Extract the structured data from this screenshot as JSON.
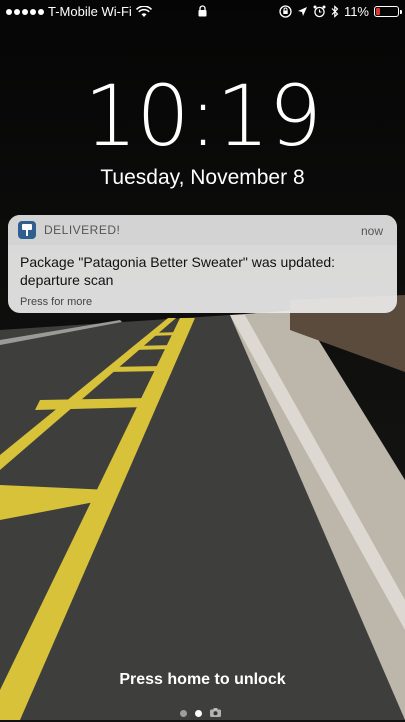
{
  "status_bar": {
    "carrier": "T-Mobile Wi-Fi",
    "battery_percent": "11%",
    "battery_level": 0.11,
    "icons": [
      "signal-dots-icon",
      "wifi-icon",
      "lock-icon",
      "orientation-lock-icon",
      "location-arrow-icon",
      "alarm-icon",
      "bluetooth-icon",
      "battery-icon"
    ]
  },
  "lock_screen": {
    "time": "10:19",
    "date": "Tuesday, November 8",
    "unlock_hint": "Press home to unlock"
  },
  "notification": {
    "app_name": "DELIVERED!",
    "time": "now",
    "message": "Package \"Patagonia Better Sweater\" was updated: departure scan",
    "more_hint": "Press for more",
    "app_icon": "package-app-icon"
  },
  "pager": {
    "pages": 3,
    "active_index": 1,
    "last_icon": "camera-icon"
  },
  "colors": {
    "battery_low": "#e0342c",
    "road_line_yellow": "#d8c23a"
  }
}
